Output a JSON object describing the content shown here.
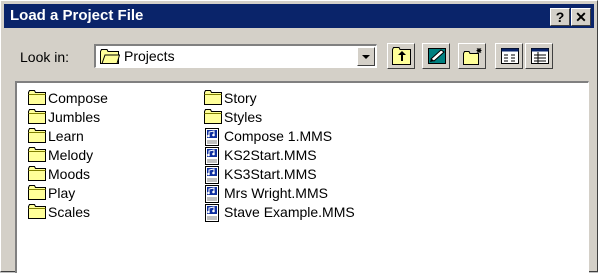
{
  "dialog": {
    "title": "Load a Project File"
  },
  "titlebar": {
    "help_label": "?",
    "close_label": "✕"
  },
  "lookin": {
    "label": "Look in:",
    "value": "Projects"
  },
  "files": [
    {
      "name": "Compose",
      "type": "folder"
    },
    {
      "name": "Jumbles",
      "type": "folder"
    },
    {
      "name": "Learn",
      "type": "folder"
    },
    {
      "name": "Melody",
      "type": "folder"
    },
    {
      "name": "Moods",
      "type": "folder"
    },
    {
      "name": "Play",
      "type": "folder"
    },
    {
      "name": "Scales",
      "type": "folder"
    },
    {
      "name": "Story",
      "type": "folder"
    },
    {
      "name": "Styles",
      "type": "folder"
    },
    {
      "name": "Compose 1.MMS",
      "type": "file"
    },
    {
      "name": "KS2Start.MMS",
      "type": "file"
    },
    {
      "name": "KS3Start.MMS",
      "type": "file"
    },
    {
      "name": "Mrs Wright.MMS",
      "type": "file"
    },
    {
      "name": "Stave Example.MMS",
      "type": "file"
    }
  ],
  "colors": {
    "titlebar": "#0a246a",
    "folder": "#ffff99",
    "window": "#d4d0c8"
  }
}
